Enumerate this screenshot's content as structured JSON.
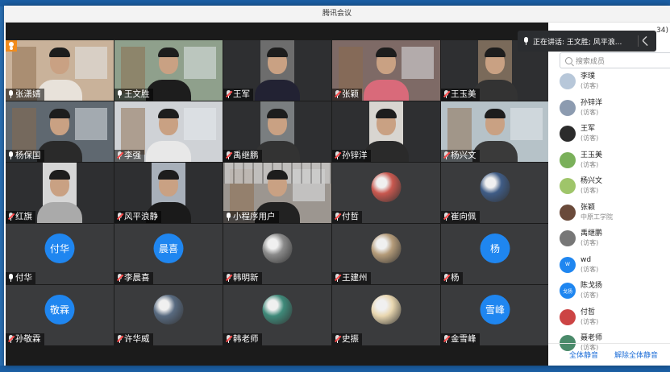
{
  "window": {
    "title": "腾讯会议"
  },
  "speaker": {
    "text": "正在讲话: 王文胜; 风平浪..."
  },
  "panel": {
    "count": "34)",
    "search_placeholder": "搜索成员",
    "members": [
      {
        "name": "李璞",
        "role": "(访客)",
        "color": "#b7c7d9"
      },
      {
        "name": "孙锌洋",
        "role": "(访客)",
        "color": "#8c9bb0"
      },
      {
        "name": "王军",
        "role": "(访客)",
        "color": "#2b2b2b"
      },
      {
        "name": "王玉美",
        "role": "(访客)",
        "color": "#7ab05a"
      },
      {
        "name": "杨兴文",
        "role": "(访客)",
        "color": "#9fc56a"
      },
      {
        "name": "张颖",
        "role": "中原工学院",
        "color": "#6a4a3a"
      },
      {
        "name": "禹继鹏",
        "role": "(访客)",
        "color": "#777"
      },
      {
        "name": "wd",
        "role": "(访客)",
        "color": "#1f86f0",
        "initial": "W"
      },
      {
        "name": "陈戈扬",
        "role": "(访客)",
        "color": "#1f86f0",
        "initial": "戈扬"
      },
      {
        "name": "付哲",
        "role": "(访客)",
        "color": "#c44"
      },
      {
        "name": "聂老师",
        "role": "(访客)",
        "color": "#4a8a6a"
      }
    ],
    "mute_all": "全体静音",
    "unmute_all": "解除全体静音"
  },
  "participants": [
    {
      "name": "张潇婧",
      "type": "video",
      "bg": "#c9b29a",
      "shirt": "#e8e2da",
      "host": true
    },
    {
      "name": "王文胜",
      "type": "video",
      "bg": "#8fa08c",
      "shirt": "#1d1d1d",
      "active": true
    },
    {
      "name": "王军",
      "type": "video",
      "bg": "#6d6d6d",
      "shirt": "#223",
      "narrow": true
    },
    {
      "name": "张颖",
      "type": "video",
      "bg": "#7e6a66",
      "shirt": "#d96a7a"
    },
    {
      "name": "王玉美",
      "type": "video",
      "bg": "#7a6a5a",
      "shirt": "#333",
      "narrow": true
    },
    {
      "name": "杨保国",
      "type": "video",
      "bg": "#5f6870",
      "shirt": "#2a2a2a"
    },
    {
      "name": "李强",
      "type": "video",
      "bg": "#cfd2d6",
      "shirt": "#e8e8e8"
    },
    {
      "name": "禹继鹏",
      "type": "video",
      "bg": "#7a7e80",
      "shirt": "#333",
      "narrow": true
    },
    {
      "name": "孙锌洋",
      "type": "video",
      "bg": "#d8d5d0",
      "shirt": "#2a2a2a",
      "narrow": true
    },
    {
      "name": "杨兴文",
      "type": "video",
      "bg": "#b6c2c8",
      "shirt": "#3a3a3a"
    },
    {
      "name": "红旗",
      "type": "video",
      "bg": "#d6d6d6",
      "shirt": "#aaa",
      "narrow": true
    },
    {
      "name": "风平浪静",
      "type": "video",
      "bg": "#a8b0ba",
      "shirt": "#1a1a1a",
      "narrow": true
    },
    {
      "name": "小程序用户",
      "type": "video",
      "bg": "#9c9690",
      "shirt": "#222",
      "ceiling": true
    },
    {
      "name": "付哲",
      "type": "image",
      "img": "#c9584f"
    },
    {
      "name": "崔向佩",
      "type": "image",
      "img": "#3f5c86"
    },
    {
      "name": "付华",
      "type": "initials",
      "initials": "付华"
    },
    {
      "name": "李晨喜",
      "type": "initials",
      "initials": "晨喜"
    },
    {
      "name": "韩明新",
      "type": "image",
      "img": "#8a8a8a"
    },
    {
      "name": "王建州",
      "type": "image",
      "img": "#b59c7a"
    },
    {
      "name": "杨",
      "type": "initials",
      "initials": "杨"
    },
    {
      "name": "孙敬霖",
      "type": "initials",
      "initials": "敬霖"
    },
    {
      "name": "许华威",
      "type": "image",
      "img": "#586a80"
    },
    {
      "name": "韩老师",
      "type": "image",
      "img": "#3f8a7a"
    },
    {
      "name": "史振",
      "type": "image",
      "img": "#e9d7b0"
    },
    {
      "name": "金雪峰",
      "type": "initials",
      "initials": "雪峰"
    }
  ]
}
